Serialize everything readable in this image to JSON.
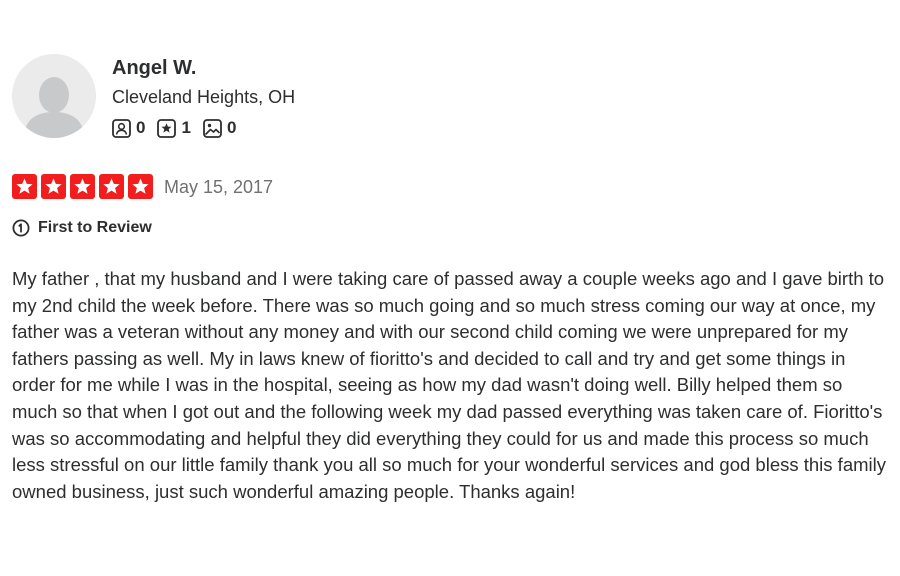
{
  "user": {
    "name": "Angel W.",
    "location": "Cleveland Heights, OH",
    "stats": {
      "friends": "0",
      "reviews": "1",
      "photos": "0"
    }
  },
  "review": {
    "rating": 5,
    "rating_max": 5,
    "date": "May 15, 2017",
    "badge": "First to Review",
    "text": "My father , that my husband and I were taking care of passed away a couple weeks ago and I gave birth to my 2nd child the week before. There was so much going and so much stress coming our way at once, my father was a veteran without any money and with our second child coming we were unprepared for my fathers passing as well. My in laws knew of fioritto's and decided to call and try and get some things in order for me while I was in the hospital, seeing as how my dad wasn't doing well. Billy helped them so much so that when I got out and the following week my dad passed everything was taken care of. Fioritto's was so accommodating and helpful they did everything they could for us and made this process so much less stressful on our little family thank you all so much for your wonderful services and god bless this family owned business, just such wonderful amazing people. Thanks again!"
  },
  "colors": {
    "star": "#f21e1e",
    "text": "#2d2e2f",
    "muted": "#6e7072",
    "avatar_bg": "#ebebeb",
    "avatar_fg": "#c8c9ca"
  },
  "icons": {
    "friends": "friends-icon",
    "reviews": "review-star-icon",
    "photos": "photo-icon",
    "badge": "first-review-icon",
    "avatar": "default-avatar-icon",
    "star": "star-icon"
  }
}
